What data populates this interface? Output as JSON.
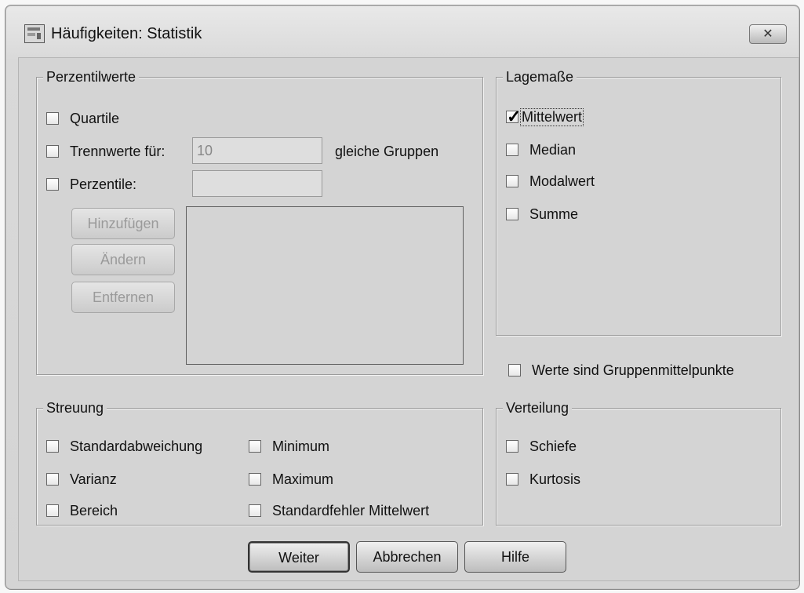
{
  "window": {
    "title": "Häufigkeiten: Statistik",
    "close_symbol": "✕"
  },
  "perzentilwerte": {
    "legend": "Perzentilwerte",
    "quartile_label": "Quartile",
    "trennwerte_label": "Trennwerte für:",
    "trennwerte_value": "10",
    "trennwerte_suffix": "gleiche Gruppen",
    "perzentile_label": "Perzentile:",
    "perzentile_value": "",
    "buttons": {
      "hinzufuegen": "Hinzufügen",
      "aendern": "Ändern",
      "entfernen": "Entfernen"
    }
  },
  "lagemasse": {
    "legend": "Lagemaße",
    "items": [
      {
        "label": "Mittelwert",
        "checked": true
      },
      {
        "label": "Median",
        "checked": false
      },
      {
        "label": "Modalwert",
        "checked": false
      },
      {
        "label": "Summe",
        "checked": false
      }
    ]
  },
  "gruppenmittelpunkte": {
    "label": "Werte sind Gruppenmittelpunkte",
    "checked": false
  },
  "streuung": {
    "legend": "Streuung",
    "standardabweichung": "Standardabweichung",
    "varianz": "Varianz",
    "bereich": "Bereich",
    "minimum": "Minimum",
    "maximum": "Maximum",
    "standardfehler": "Standardfehler Mittelwert"
  },
  "verteilung": {
    "legend": "Verteilung",
    "schiefe": "Schiefe",
    "kurtosis": "Kurtosis"
  },
  "footer": {
    "weiter": "Weiter",
    "abbrechen": "Abbrechen",
    "hilfe": "Hilfe"
  }
}
